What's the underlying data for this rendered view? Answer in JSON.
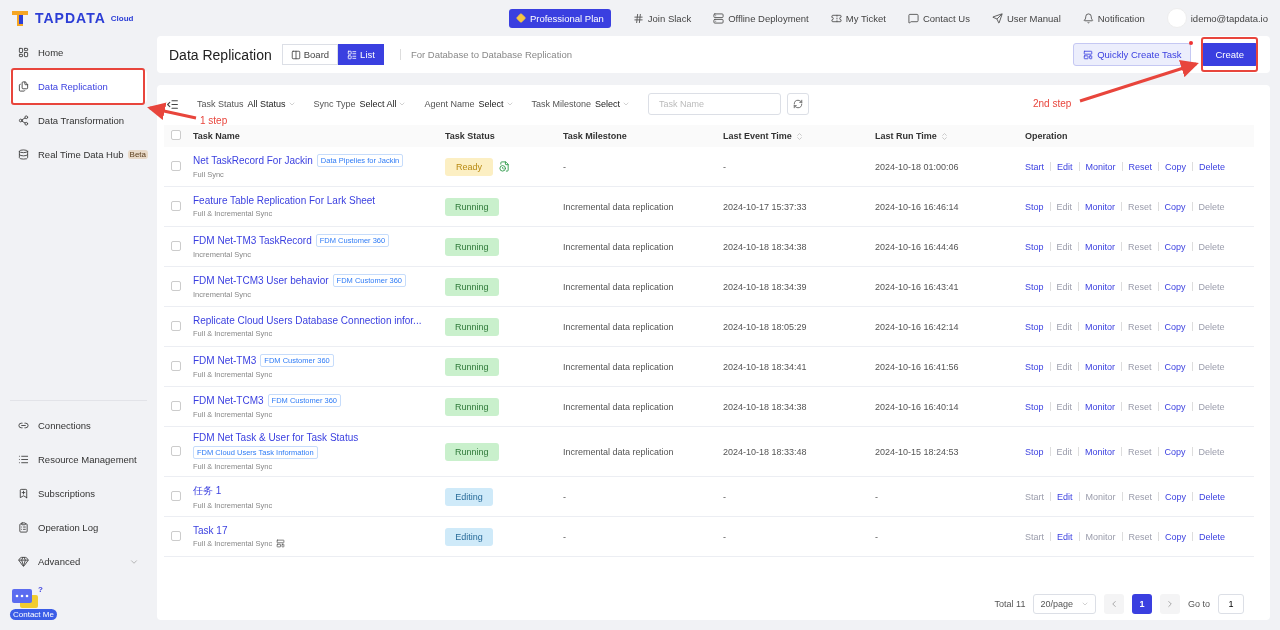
{
  "brand": {
    "name": "TAPDATA",
    "edition": "Cloud"
  },
  "top_nav": {
    "plan": "Professional Plan",
    "links": [
      {
        "label": "Join Slack",
        "kind": "slack"
      },
      {
        "label": "Offline Deployment",
        "kind": "server"
      },
      {
        "label": "My Ticket",
        "kind": "ticket"
      },
      {
        "label": "Contact Us",
        "kind": "chat"
      },
      {
        "label": "User Manual",
        "kind": "send"
      },
      {
        "label": "Notification",
        "kind": "bell"
      }
    ],
    "user": "idemo@tapdata.io"
  },
  "sidebar": {
    "items": [
      {
        "label": "Home",
        "kind": "home",
        "selected": false
      },
      {
        "label": "Data Replication",
        "kind": "replication",
        "selected": true
      },
      {
        "label": "Data Transformation",
        "kind": "transform",
        "selected": false
      },
      {
        "label": "Real Time Data Hub",
        "kind": "hub",
        "selected": false,
        "badge": "Beta"
      }
    ],
    "bottom_items": [
      {
        "label": "Connections",
        "kind": "connections"
      },
      {
        "label": "Resource Management",
        "kind": "resources"
      },
      {
        "label": "Subscriptions",
        "kind": "subscriptions"
      },
      {
        "label": "Operation Log",
        "kind": "log"
      },
      {
        "label": "Advanced",
        "kind": "advanced",
        "expanded": false
      }
    ],
    "contact": {
      "label": "Contact Me",
      "mark": "?"
    }
  },
  "header": {
    "title": "Data Replication",
    "views": [
      {
        "label": "Board",
        "kind": "board",
        "selected": false
      },
      {
        "label": "List",
        "kind": "list",
        "selected": true
      }
    ],
    "subtitle": "For Database to Database Replication",
    "quick_button": "Quickly Create Task",
    "quick_dot": true,
    "create_button": "Create"
  },
  "filters": [
    {
      "label": "Task Status",
      "value": "All Status"
    },
    {
      "label": "Sync Type",
      "value": "Select All"
    },
    {
      "label": "Agent Name",
      "value": "Select"
    },
    {
      "label": "Task Milestone",
      "value": "Select"
    }
  ],
  "search": {
    "placeholder": "Task Name"
  },
  "table": {
    "all_selected": false,
    "columns": [
      {
        "label": "Task Name",
        "sortable": false
      },
      {
        "label": "Task Status",
        "sortable": false
      },
      {
        "label": "Task Milestone",
        "sortable": false
      },
      {
        "label": "Last Event Time",
        "sortable": true
      },
      {
        "label": "Last Run Time",
        "sortable": true
      },
      {
        "label": "Operation",
        "sortable": false
      }
    ],
    "rows": [
      {
        "name": "Net TaskRecord For Jackin",
        "tag": "Data Pipelies for Jackin",
        "tag_below": false,
        "sync": "Full Sync",
        "sync_icon": false,
        "status": "Ready",
        "kind": "ready",
        "status_icon": true,
        "milestone": "-",
        "event": "-",
        "run": "2024-10-18 01:00:06",
        "selected": false,
        "ops": [
          {
            "label": "Start",
            "disabled": false
          },
          {
            "label": "Edit",
            "disabled": false
          },
          {
            "label": "Monitor",
            "disabled": false
          },
          {
            "label": "Reset",
            "disabled": false
          },
          {
            "label": "Copy",
            "disabled": false
          },
          {
            "label": "Delete",
            "disabled": false
          }
        ]
      },
      {
        "name": "Feature Table Replication For Lark Sheet",
        "sync": "Full & Incremental Sync",
        "sync_icon": false,
        "status": "Running",
        "kind": "running",
        "status_icon": false,
        "milestone": "Incremental data replication",
        "event": "2024-10-17 15:37:33",
        "run": "2024-10-16 16:46:14",
        "selected": false,
        "ops": [
          {
            "label": "Stop",
            "disabled": false
          },
          {
            "label": "Edit",
            "disabled": true
          },
          {
            "label": "Monitor",
            "disabled": false
          },
          {
            "label": "Reset",
            "disabled": true
          },
          {
            "label": "Copy",
            "disabled": false
          },
          {
            "label": "Delete",
            "disabled": true
          }
        ]
      },
      {
        "name": "FDM Net-TM3 TaskRecord",
        "tag": "FDM Customer 360",
        "tag_below": false,
        "sync": "Incremental Sync",
        "sync_icon": false,
        "status": "Running",
        "kind": "running",
        "status_icon": false,
        "milestone": "Incremental data replication",
        "event": "2024-10-18 18:34:38",
        "run": "2024-10-16 16:44:46",
        "selected": false,
        "ops": [
          {
            "label": "Stop",
            "disabled": false
          },
          {
            "label": "Edit",
            "disabled": true
          },
          {
            "label": "Monitor",
            "disabled": false
          },
          {
            "label": "Reset",
            "disabled": true
          },
          {
            "label": "Copy",
            "disabled": false
          },
          {
            "label": "Delete",
            "disabled": true
          }
        ]
      },
      {
        "name": "FDM Net-TCM3 User behavior",
        "tag": "FDM Customer 360",
        "tag_below": false,
        "sync": "Incremental Sync",
        "sync_icon": false,
        "status": "Running",
        "kind": "running",
        "status_icon": false,
        "milestone": "Incremental data replication",
        "event": "2024-10-18 18:34:39",
        "run": "2024-10-16 16:43:41",
        "selected": false,
        "ops": [
          {
            "label": "Stop",
            "disabled": false
          },
          {
            "label": "Edit",
            "disabled": true
          },
          {
            "label": "Monitor",
            "disabled": false
          },
          {
            "label": "Reset",
            "disabled": true
          },
          {
            "label": "Copy",
            "disabled": false
          },
          {
            "label": "Delete",
            "disabled": true
          }
        ]
      },
      {
        "name": "Replicate Cloud Users Database Connection infor...",
        "sync": "Full & Incremental Sync",
        "sync_icon": false,
        "status": "Running",
        "kind": "running",
        "status_icon": false,
        "milestone": "Incremental data replication",
        "event": "2024-10-18 18:05:29",
        "run": "2024-10-16 16:42:14",
        "selected": false,
        "ops": [
          {
            "label": "Stop",
            "disabled": false
          },
          {
            "label": "Edit",
            "disabled": true
          },
          {
            "label": "Monitor",
            "disabled": false
          },
          {
            "label": "Reset",
            "disabled": true
          },
          {
            "label": "Copy",
            "disabled": false
          },
          {
            "label": "Delete",
            "disabled": true
          }
        ]
      },
      {
        "name": "FDM Net-TM3",
        "tag": "FDM Customer 360",
        "tag_below": false,
        "sync": "Full & Incremental Sync",
        "sync_icon": false,
        "status": "Running",
        "kind": "running",
        "status_icon": false,
        "milestone": "Incremental data replication",
        "event": "2024-10-18 18:34:41",
        "run": "2024-10-16 16:41:56",
        "selected": false,
        "ops": [
          {
            "label": "Stop",
            "disabled": false
          },
          {
            "label": "Edit",
            "disabled": true
          },
          {
            "label": "Monitor",
            "disabled": false
          },
          {
            "label": "Reset",
            "disabled": true
          },
          {
            "label": "Copy",
            "disabled": false
          },
          {
            "label": "Delete",
            "disabled": true
          }
        ]
      },
      {
        "name": "FDM Net-TCM3",
        "tag": "FDM Customer 360",
        "tag_below": false,
        "sync": "Full & Incremental Sync",
        "sync_icon": false,
        "status": "Running",
        "kind": "running",
        "status_icon": false,
        "milestone": "Incremental data replication",
        "event": "2024-10-18 18:34:38",
        "run": "2024-10-16 16:40:14",
        "selected": false,
        "ops": [
          {
            "label": "Stop",
            "disabled": false
          },
          {
            "label": "Edit",
            "disabled": true
          },
          {
            "label": "Monitor",
            "disabled": false
          },
          {
            "label": "Reset",
            "disabled": true
          },
          {
            "label": "Copy",
            "disabled": false
          },
          {
            "label": "Delete",
            "disabled": true
          }
        ]
      },
      {
        "name": "FDM Net Task & User for Task Status",
        "tag": "FDM Cloud Users Task Information",
        "tag_below": true,
        "sync": "Full & Incremental Sync",
        "sync_icon": false,
        "status": "Running",
        "kind": "running",
        "status_icon": false,
        "milestone": "Incremental data replication",
        "event": "2024-10-18 18:33:48",
        "run": "2024-10-15 18:24:53",
        "selected": false,
        "ops": [
          {
            "label": "Stop",
            "disabled": false
          },
          {
            "label": "Edit",
            "disabled": true
          },
          {
            "label": "Monitor",
            "disabled": false
          },
          {
            "label": "Reset",
            "disabled": true
          },
          {
            "label": "Copy",
            "disabled": false
          },
          {
            "label": "Delete",
            "disabled": true
          }
        ]
      },
      {
        "name": "任务 1",
        "sync": "Full & Incremental Sync",
        "sync_icon": false,
        "status": "Editing",
        "kind": "editing",
        "status_icon": false,
        "milestone": "-",
        "event": "-",
        "run": "-",
        "selected": false,
        "ops": [
          {
            "label": "Start",
            "disabled": true
          },
          {
            "label": "Edit",
            "disabled": false
          },
          {
            "label": "Monitor",
            "disabled": true
          },
          {
            "label": "Reset",
            "disabled": true
          },
          {
            "label": "Copy",
            "disabled": false
          },
          {
            "label": "Delete",
            "disabled": false
          }
        ]
      },
      {
        "name": "Task 17",
        "sync": "Full & Incremental Sync",
        "sync_icon": true,
        "status": "Editing",
        "kind": "editing",
        "status_icon": false,
        "milestone": "-",
        "event": "-",
        "run": "-",
        "selected": false,
        "ops": [
          {
            "label": "Start",
            "disabled": true
          },
          {
            "label": "Edit",
            "disabled": false
          },
          {
            "label": "Monitor",
            "disabled": true
          },
          {
            "label": "Reset",
            "disabled": true
          },
          {
            "label": "Copy",
            "disabled": false
          },
          {
            "label": "Delete",
            "disabled": false
          }
        ]
      }
    ]
  },
  "pagination": {
    "total": "Total 11",
    "page_size": "20/page",
    "pages": [
      {
        "label": "1",
        "selected": true
      }
    ],
    "goto_label": "Go to",
    "goto_value": "1"
  },
  "annotations": [
    {
      "kind": "sidebar",
      "text": "1 step"
    },
    {
      "kind": "create",
      "text": "2nd step"
    }
  ]
}
